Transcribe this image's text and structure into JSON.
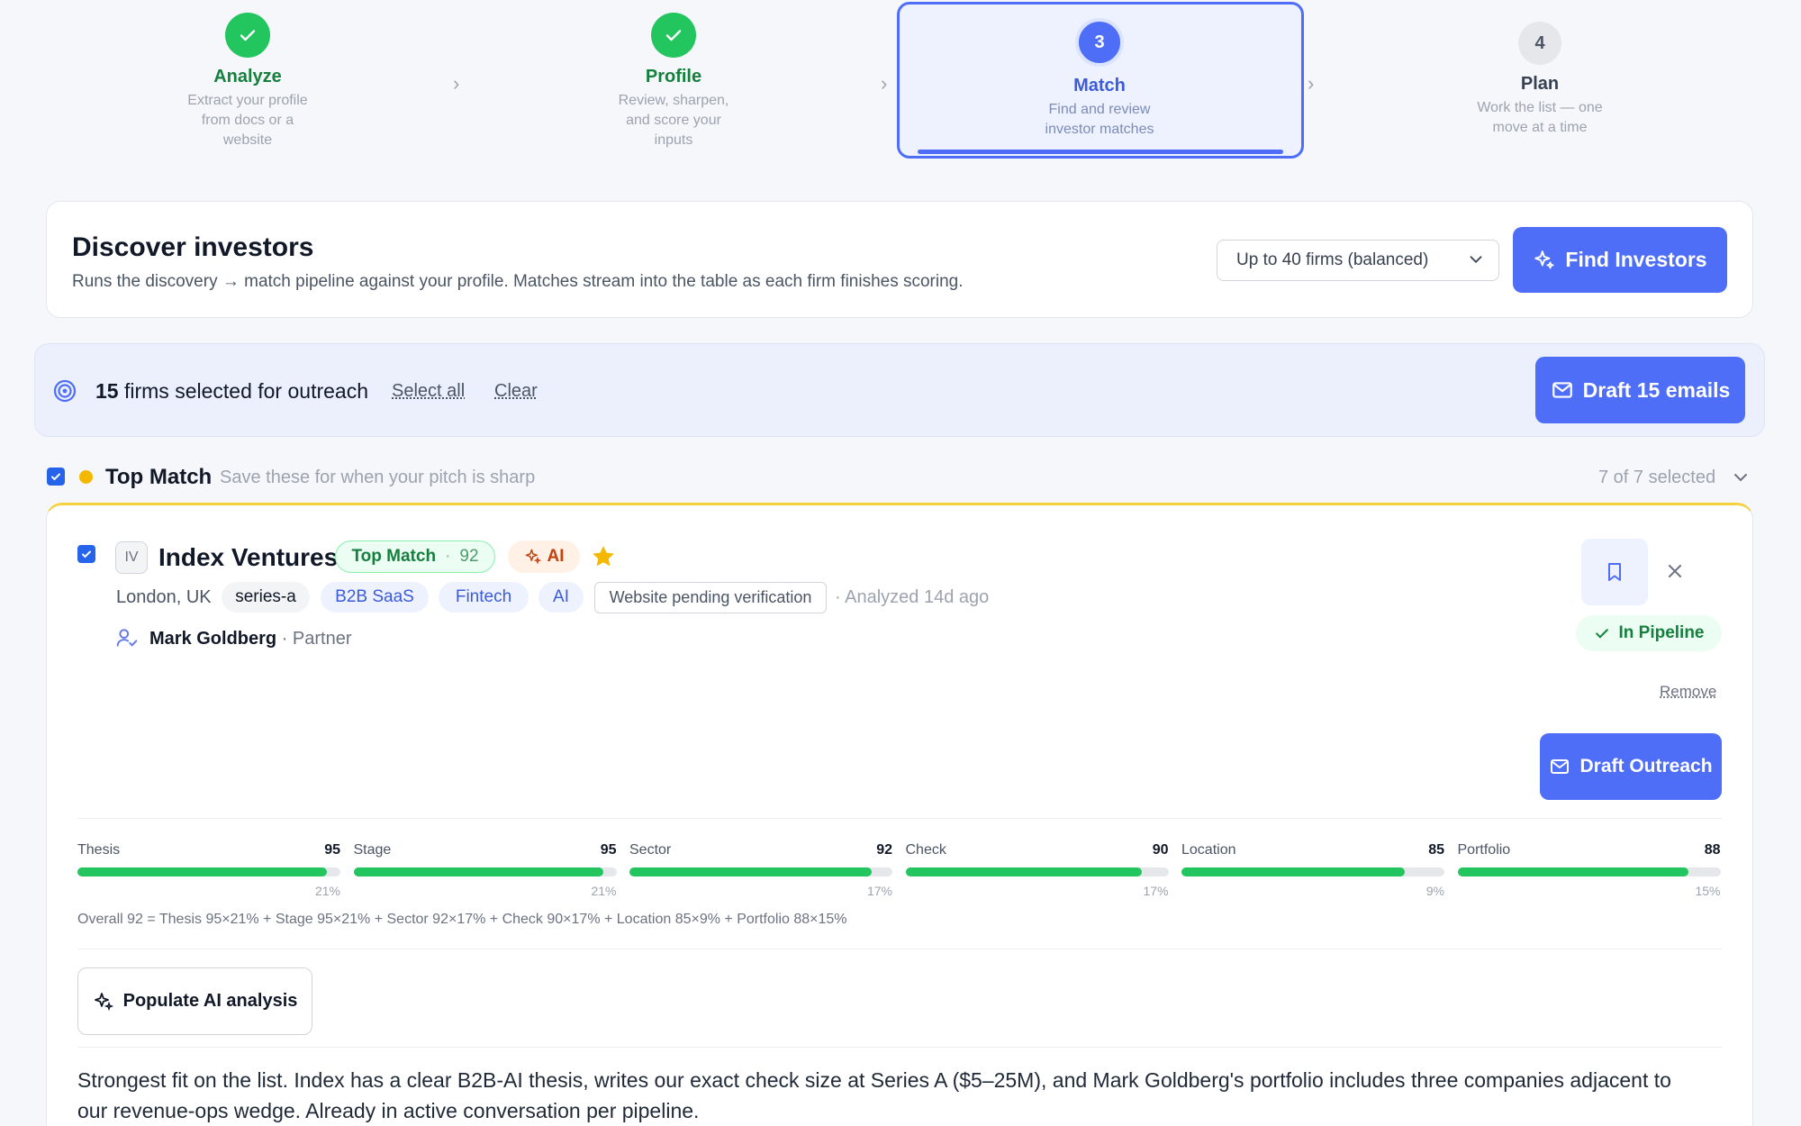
{
  "steps": [
    {
      "title": "Analyze",
      "desc_lines": [
        "Extract your profile",
        "from docs or a",
        "website"
      ],
      "state": "done"
    },
    {
      "title": "Profile",
      "desc_lines": [
        "Review, sharpen,",
        "and score your",
        "inputs"
      ],
      "state": "done"
    },
    {
      "number": "3",
      "title": "Match",
      "desc_lines": [
        "Find and review",
        "investor matches"
      ],
      "state": "active"
    },
    {
      "number": "4",
      "title": "Plan",
      "desc_lines": [
        "Work the list — one",
        "move at a time"
      ],
      "state": "todo"
    }
  ],
  "discover": {
    "title": "Discover investors",
    "subtitle": "Runs the discovery → match pipeline against your profile. Matches stream into the table as each firm finishes scoring.",
    "select_value": "Up to 40 firms (balanced)",
    "find_button": "Find Investors"
  },
  "selection": {
    "count": "15",
    "text": "firms selected for outreach",
    "select_all": "Select all",
    "clear": "Clear",
    "draft_button": "Draft 15 emails"
  },
  "group": {
    "title": "Top Match",
    "subtitle": "Save these for when your pitch is sharp",
    "selected_text": "7 of 7 selected"
  },
  "investor": {
    "initials": "IV",
    "name": "Index Ventures",
    "badge_label": "Top Match",
    "badge_score": "92",
    "ai_label": "AI",
    "location": "London, UK",
    "tags": [
      "series-a",
      "B2B SaaS",
      "Fintech",
      "AI"
    ],
    "verification": "Website pending verification",
    "analyzed": "· Analyzed 14d ago",
    "contact_name": "Mark Goldberg",
    "contact_role": "· Partner",
    "pipeline_label": "In Pipeline",
    "remove_label": "Remove",
    "draft_outreach": "Draft Outreach",
    "scores": [
      {
        "label": "Thesis",
        "value": 95,
        "weight": "21%"
      },
      {
        "label": "Stage",
        "value": 95,
        "weight": "21%"
      },
      {
        "label": "Sector",
        "value": 92,
        "weight": "17%"
      },
      {
        "label": "Check",
        "value": 90,
        "weight": "17%"
      },
      {
        "label": "Location",
        "value": 85,
        "weight": "9%"
      },
      {
        "label": "Portfolio",
        "value": 88,
        "weight": "15%"
      }
    ],
    "formula": "Overall 92 = Thesis 95×21% + Stage 95×21% + Sector 92×17% + Check 90×17% + Location 85×9% + Portfolio 88×15%",
    "populate_button": "Populate AI analysis",
    "analysis_line1": "Strongest fit on the list. Index has a clear B2B-AI thesis, writes our exact check size at Series A ($5–25M), and Mark Goldberg's portfolio includes three companies adjacent to",
    "analysis_line2": "our revenue-ops wedge. Already in active conversation per pipeline."
  },
  "colors": {
    "accent": "#4f6ef7",
    "success": "#22c55e",
    "gold": "#f5b800"
  }
}
